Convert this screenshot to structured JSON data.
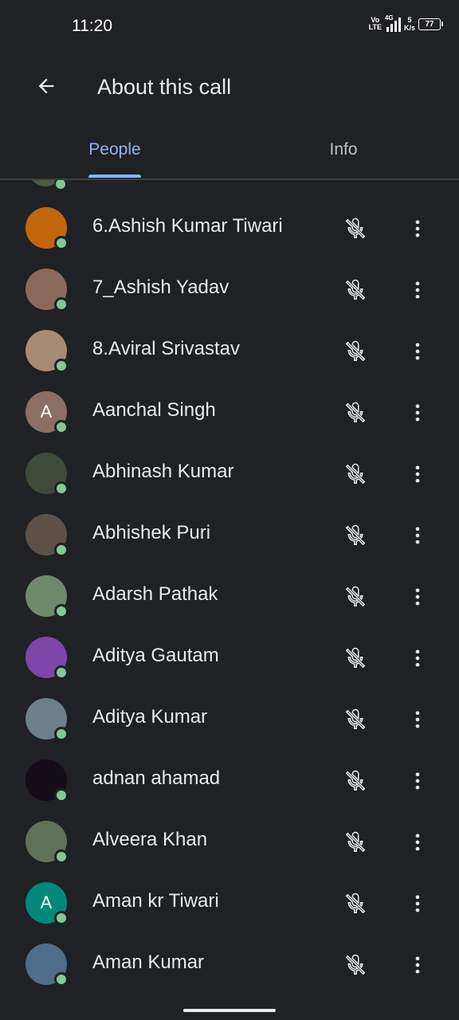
{
  "status_bar": {
    "time": "11:20",
    "volte_top": "Vo",
    "volte_bottom": "LTE",
    "network": "4G",
    "speed_value": "5",
    "speed_unit": "K/s",
    "battery": "77"
  },
  "header": {
    "title": "About this call",
    "back_icon": "arrow-back-icon"
  },
  "tabs": [
    {
      "label": "People",
      "selected": true
    },
    {
      "label": "Info",
      "selected": false
    }
  ],
  "participants": [
    {
      "name": "6.Ashish Kumar Tiwari",
      "avatar_color": "#c2660e"
    },
    {
      "name": "7_Ashish Yadav",
      "avatar_color": "#8b6a5c"
    },
    {
      "name": "8.Aviral Srivastav",
      "avatar_color": "#a78a73"
    },
    {
      "name": "Aanchal Singh",
      "avatar_initial": "A",
      "avatar_color": "#8d6e63"
    },
    {
      "name": "Abhinash Kumar",
      "avatar_color": "#3f4a3a"
    },
    {
      "name": "Abhishek Puri",
      "avatar_color": "#5d5047"
    },
    {
      "name": "Adarsh Pathak",
      "avatar_color": "#6f8a6a"
    },
    {
      "name": "Aditya Gautam",
      "avatar_color": "#7d46a8"
    },
    {
      "name": "Aditya Kumar",
      "avatar_color": "#6d7f89"
    },
    {
      "name": "adnan ahamad",
      "avatar_color": "#150c18"
    },
    {
      "name": "Alveera Khan",
      "avatar_color": "#5f7258"
    },
    {
      "name": "Aman kr Tiwari",
      "avatar_initial": "A",
      "avatar_color": "#00897b"
    },
    {
      "name": "Aman Kumar",
      "avatar_color": "#4d6d8a"
    }
  ],
  "row_icons": {
    "mic": "mic-off-icon",
    "more": "more-vert-icon"
  },
  "colors": {
    "background": "#202124",
    "accent": "#8ab4f8",
    "presence": "#81c995"
  }
}
